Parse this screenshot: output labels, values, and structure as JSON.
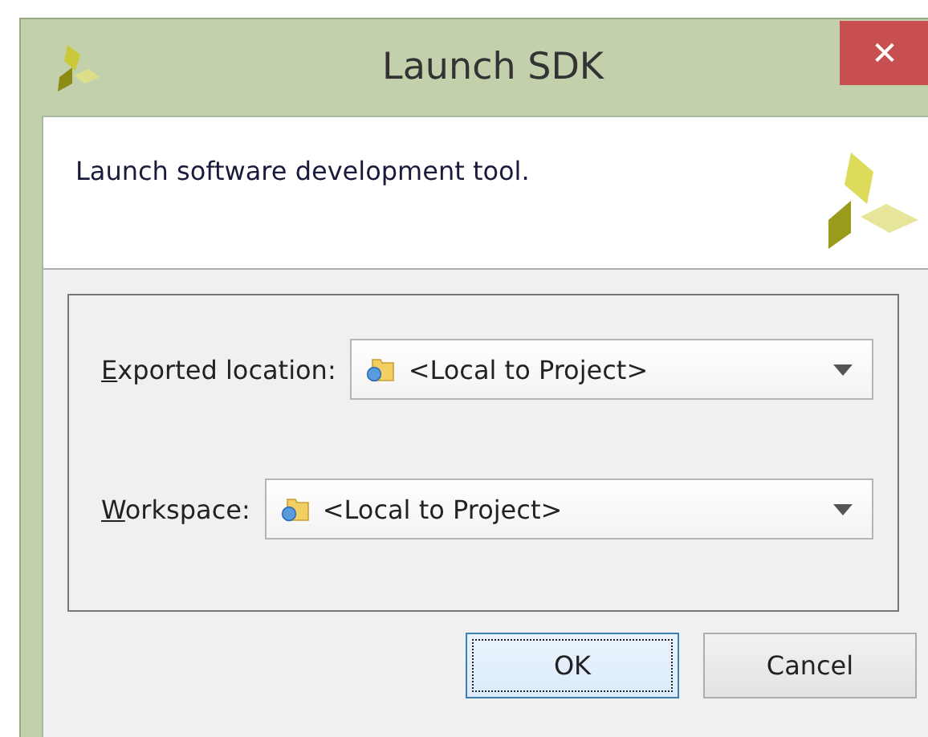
{
  "window": {
    "title": "Launch SDK",
    "close_glyph": "✕"
  },
  "header": {
    "description": "Launch software development tool."
  },
  "fields": [
    {
      "label": "Exported location:",
      "value": "<Local to Project>"
    },
    {
      "label": "Workspace:",
      "value": "<Local to Project>"
    }
  ],
  "buttons": [
    {
      "label": "OK",
      "focused": true
    },
    {
      "label": "Cancel",
      "focused": false
    }
  ]
}
